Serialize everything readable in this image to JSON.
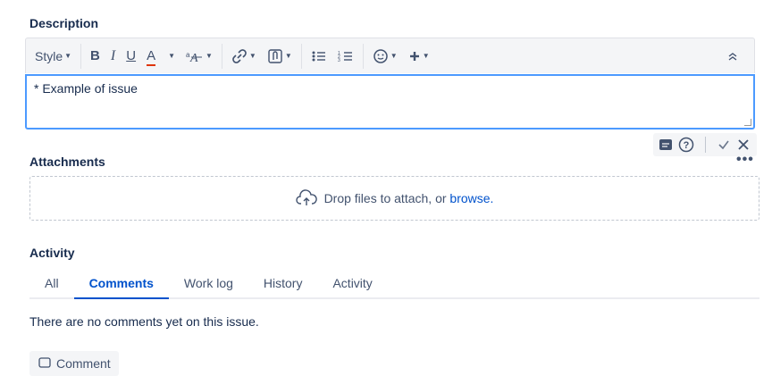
{
  "description": {
    "title": "Description",
    "toolbar": {
      "style_label": "Style",
      "bold": "B",
      "italic": "I",
      "underline": "U",
      "text_color": "A"
    },
    "editor_text": "* Example of issue"
  },
  "attachments": {
    "title": "Attachments",
    "drop_text": "Drop files to attach, or",
    "browse_link": "browse."
  },
  "activity": {
    "title": "Activity",
    "tabs": [
      {
        "label": "All"
      },
      {
        "label": "Comments"
      },
      {
        "label": "Work log"
      },
      {
        "label": "History"
      },
      {
        "label": "Activity"
      }
    ],
    "active_tab": "Comments",
    "empty_text": "There are no comments yet on this issue.",
    "comment_button": "Comment"
  },
  "colors": {
    "accent": "#0052cc",
    "focus_border": "#4c9aff",
    "text_color_bar": "#de350b"
  }
}
